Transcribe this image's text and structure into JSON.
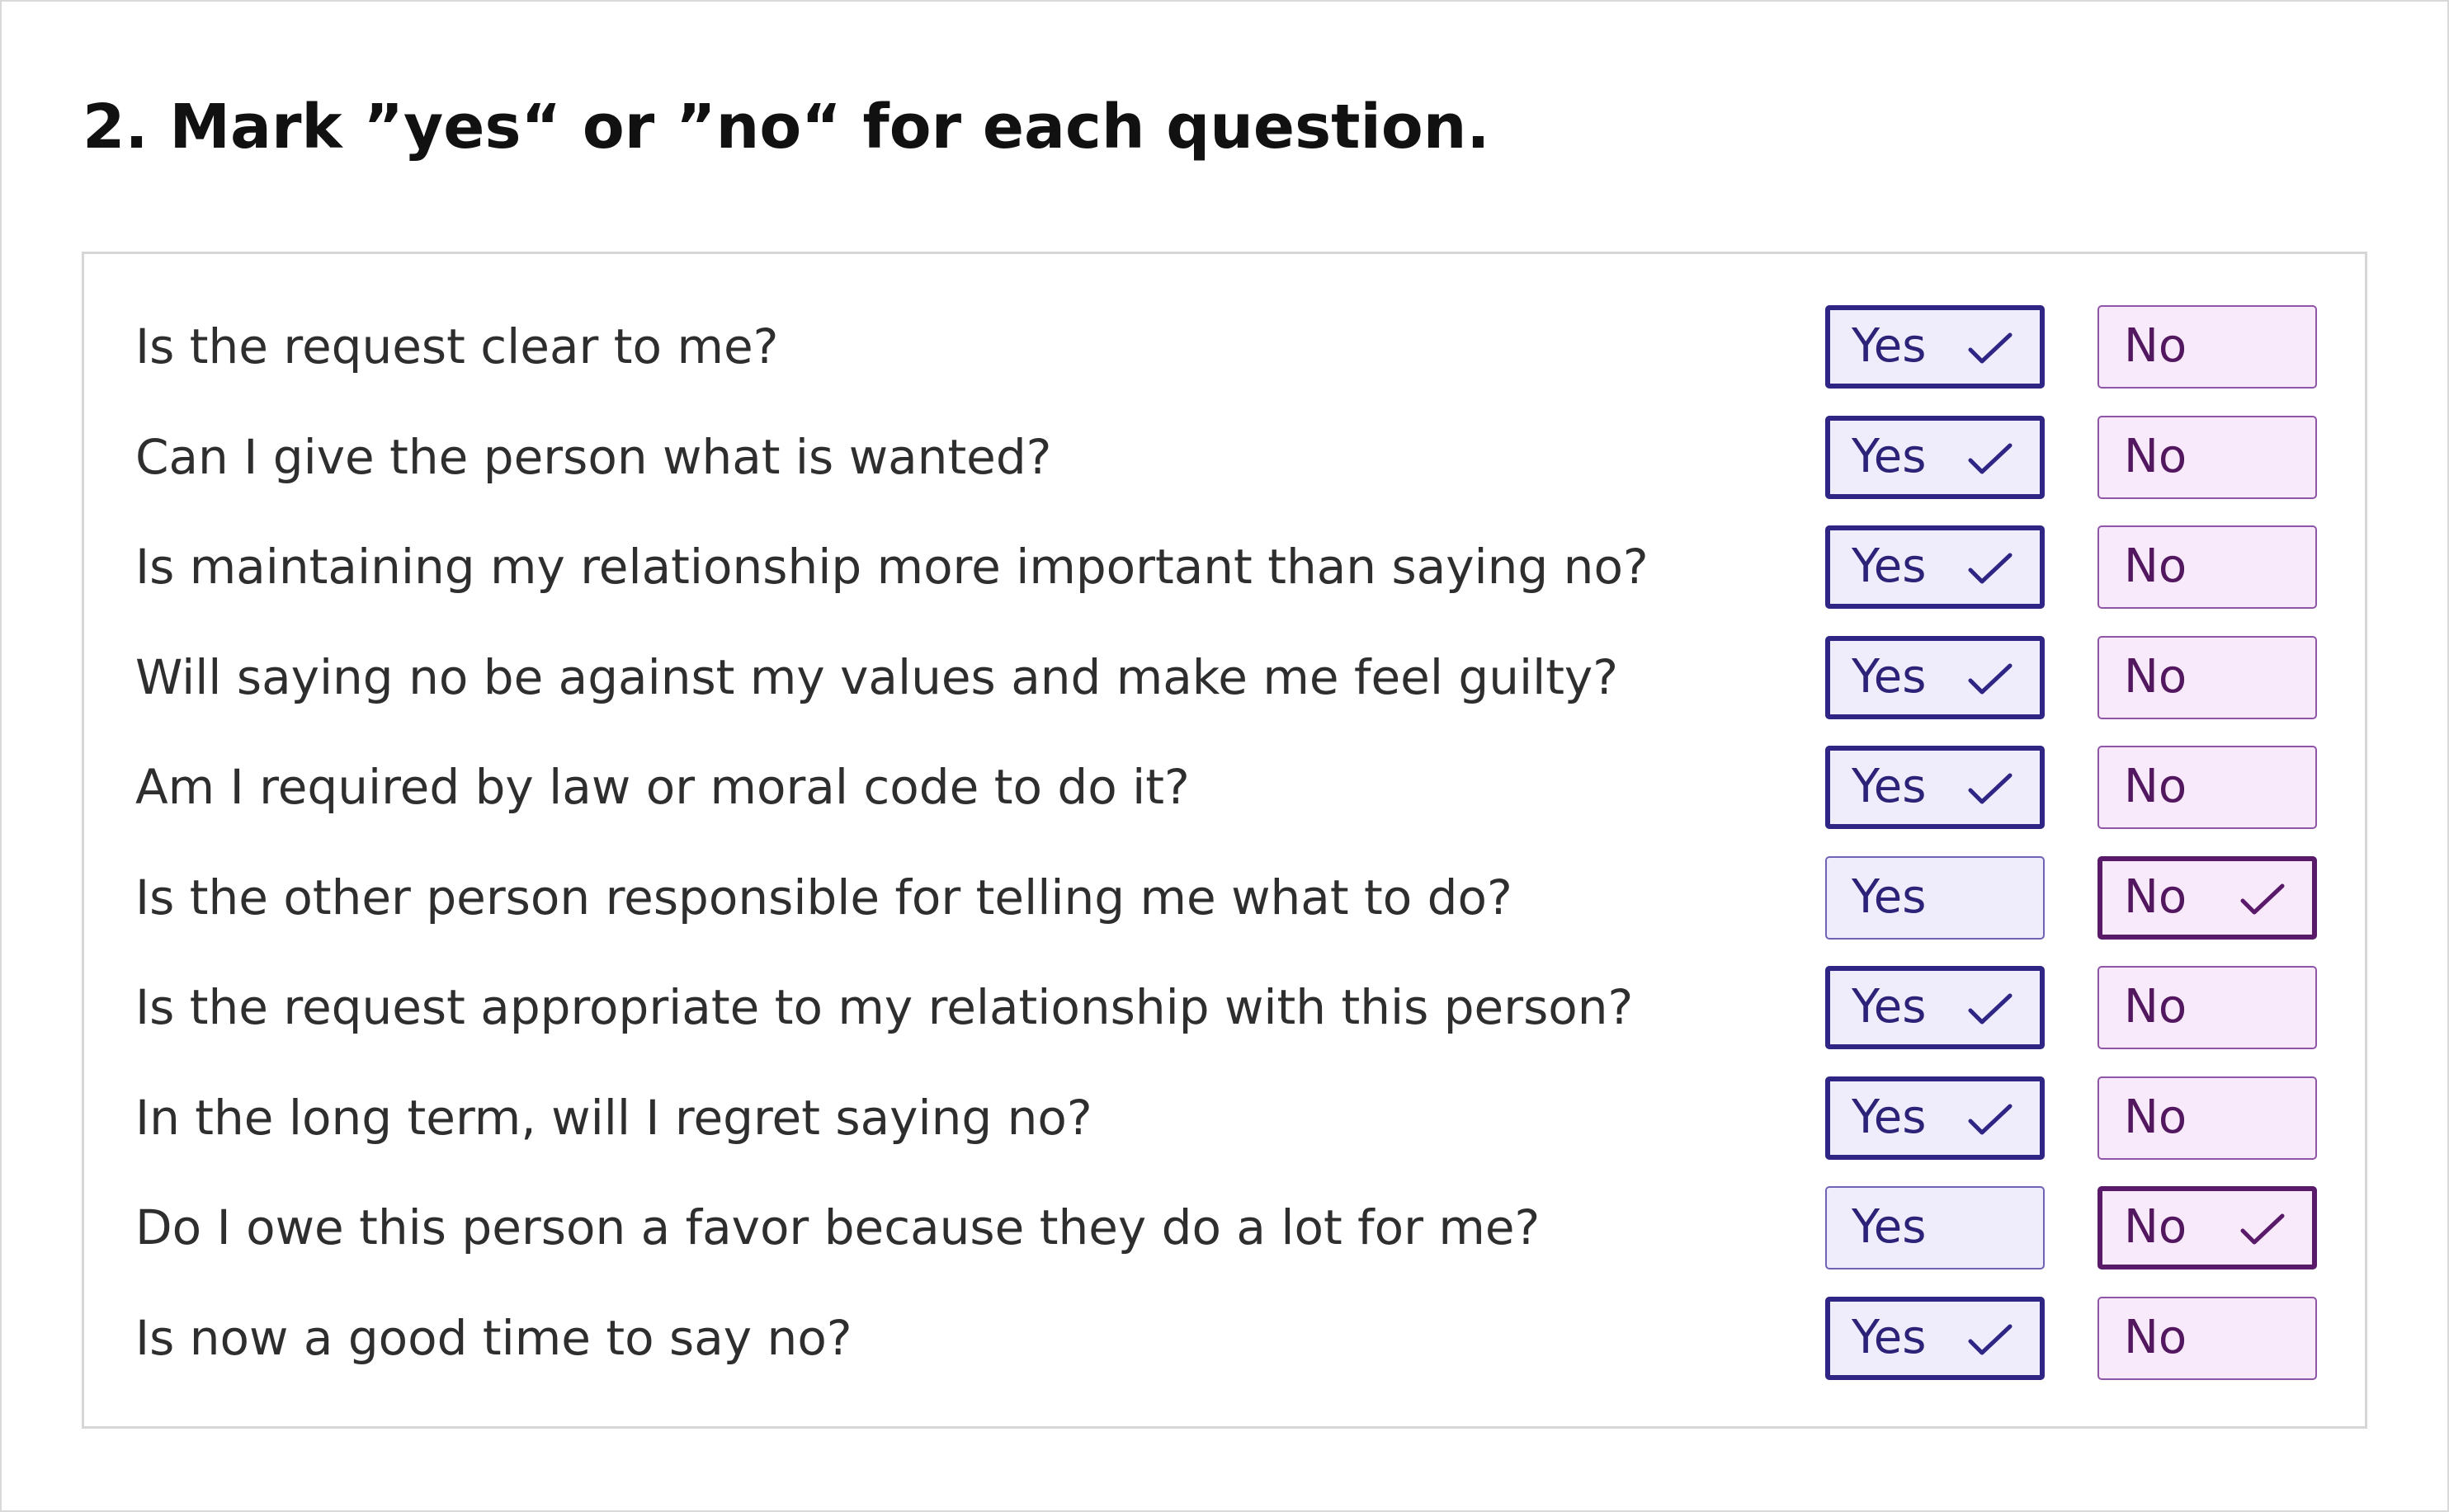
{
  "heading": "2. Mark ”yes“ or ”no“ for each question.",
  "options": {
    "yes_label": "Yes",
    "no_label": "No"
  },
  "icons": {
    "selected_mark": "checkmark-icon"
  },
  "colors": {
    "yes_fill": "#efedfc",
    "yes_border": "#2f2584",
    "no_fill": "#f8e9fb",
    "no_border": "#5a1a6a"
  },
  "questions": [
    {
      "text": "Is the request clear to me?",
      "answer": "yes"
    },
    {
      "text": "Can I give the person what is wanted?",
      "answer": "yes"
    },
    {
      "text": "Is maintaining my relationship more important than saying no?",
      "answer": "yes"
    },
    {
      "text": "Will saying no be against my values and make me feel guilty?",
      "answer": "yes"
    },
    {
      "text": "Am I required by law or moral code to do it?",
      "answer": "yes"
    },
    {
      "text": "Is the other person responsible for telling me what to do?",
      "answer": "no"
    },
    {
      "text": "Is the request appropriate to my relationship with this person?",
      "answer": "yes"
    },
    {
      "text": "In the long term, will I regret saying no?",
      "answer": "yes"
    },
    {
      "text": "Do I owe this person a favor because they do a lot for me?",
      "answer": "no"
    },
    {
      "text": "Is now a good time to say no?",
      "answer": "yes"
    }
  ]
}
